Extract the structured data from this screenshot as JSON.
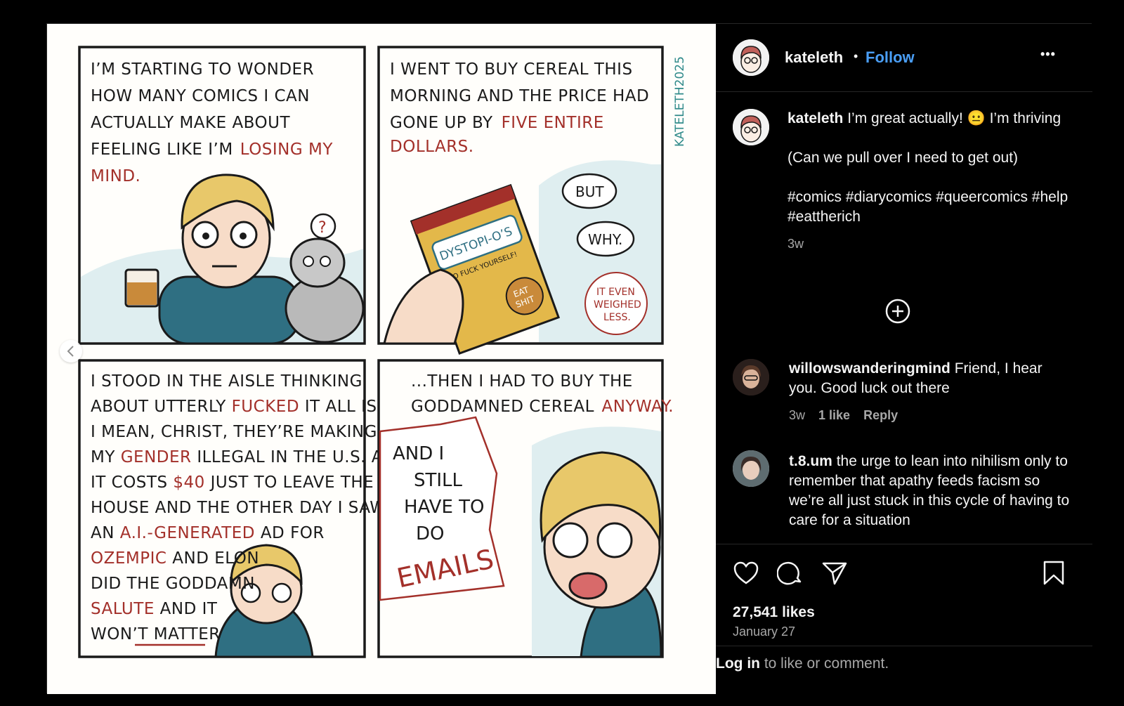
{
  "post": {
    "username": "kateleth",
    "follow_label": "Follow",
    "separator": "•",
    "more_label": "•••"
  },
  "caption": {
    "username": "kateleth",
    "line1": "I’m great actually! 😐 I’m thriving",
    "line2": "(Can we pull over I need to get out)",
    "line3": "#comics #diarycomics #queercomics #help #eattherich",
    "time": "3w"
  },
  "comments": [
    {
      "username": "willowswanderingmind",
      "text": "Friend, I hear you. Good luck out there",
      "time": "3w",
      "likes": "1 like",
      "reply_label": "Reply"
    },
    {
      "username": "t.8.um",
      "text": "the urge to lean into nihilism only to remember that apathy feeds facism so we’re all just stuck in this cycle of having to care for a situation"
    }
  ],
  "stats": {
    "likes": "27,541 likes",
    "date": "January 27"
  },
  "login": {
    "link": "Log in",
    "text": " to like or comment."
  },
  "comic": {
    "signature": "KATELETH2025",
    "panel1": [
      "I’M STARTING TO WONDER",
      "HOW MANY COMICS I CAN",
      "ACTUALLY MAKE ABOUT",
      "FEELING LIKE I’M",
      "LOSING MY",
      "MIND."
    ],
    "panel1_q": "?",
    "panel2": [
      "I WENT TO BUY CEREAL THIS",
      "MORNING AND THE PRICE HAD",
      "GONE UP BY",
      "FIVE ENTIRE",
      "DOLLARS."
    ],
    "panel2_box": "DYSTOPI-O’S",
    "panel2_box_sub": "GO FUCK YOURSELF!",
    "panel2_seal": [
      "EAT",
      "SHIT"
    ],
    "panel2_bubble1": "BUT",
    "panel2_bubble2": "WHY.",
    "panel2_note": [
      "IT EVEN",
      "WEIGHED",
      "LESS."
    ],
    "panel3": [
      [
        "I STOOD IN THE AISLE THINKING",
        ""
      ],
      [
        "ABOUT UTTERLY ",
        "FUCKED",
        " IT ALL IS."
      ],
      [
        "I MEAN, CHRIST, THEY’RE MAKING",
        ""
      ],
      [
        "MY ",
        "GENDER",
        " ILLEGAL IN THE U.S. AND"
      ],
      [
        "IT COSTS ",
        "$40",
        " JUST TO LEAVE THE"
      ],
      [
        "HOUSE AND THE OTHER DAY I SAW",
        ""
      ],
      [
        "AN ",
        "A.I.-GENERATED",
        " AD FOR"
      ],
      [
        "",
        "OZEMPIC",
        " AND ELON"
      ],
      [
        "DID THE GODDAMN",
        ""
      ],
      [
        "",
        "SALUTE",
        " AND IT"
      ],
      [
        "WON’T MATTER",
        ""
      ]
    ],
    "panel4": [
      "...THEN I HAD TO BUY THE",
      "GODDAMNED CEREAL",
      "ANYWAY."
    ],
    "panel4_burst": [
      "AND I",
      "STILL",
      "HAVE TO",
      "DO",
      "EMAILS"
    ]
  },
  "colors": {
    "accent": "#4a9ef5",
    "ink": "#1a1a1a",
    "comic_red": "#a3302a",
    "hair": "#e8c86a",
    "shirt": "#2f6f82",
    "sky": "#dfeef0"
  }
}
